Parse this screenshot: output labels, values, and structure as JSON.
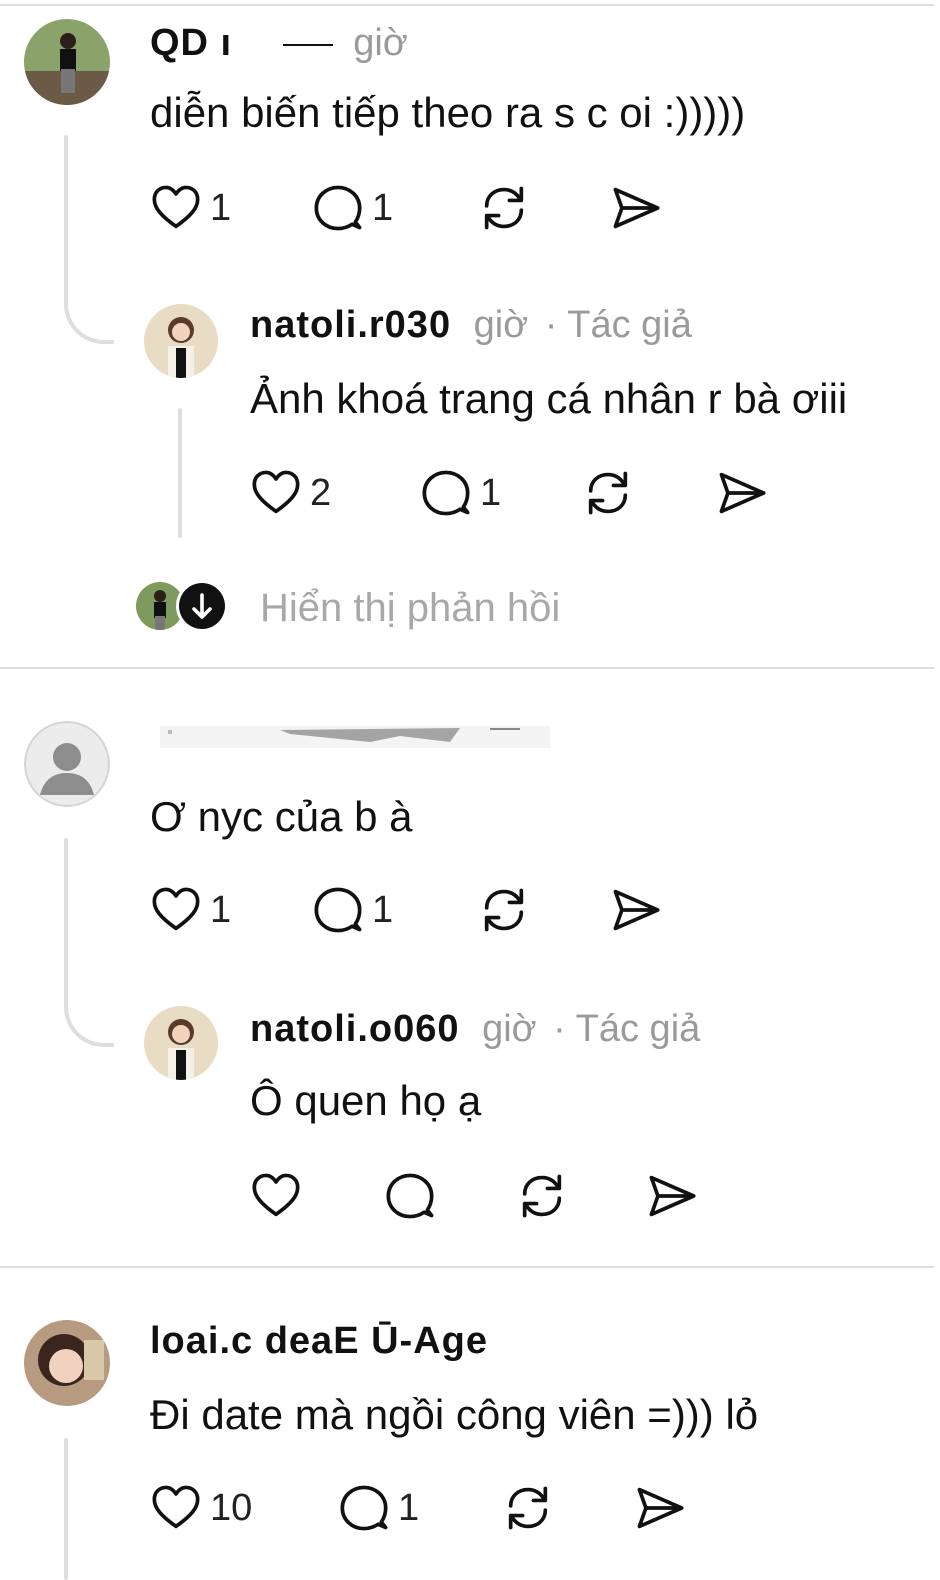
{
  "comments": [
    {
      "username": "QD ı",
      "time": "giờ",
      "text": "diễn biến tiếp theo ra s c oi :)))))",
      "likes": "1",
      "replies": "1",
      "reply": {
        "username": "natoli.r030",
        "time": "giờ",
        "author_badge": "· Tác giả",
        "text": "Ảnh khoá trang cá nhân r bà ơiii",
        "likes": "2",
        "replies": "1"
      },
      "show_replies": "Hiển thị phản hồi"
    },
    {
      "username": "",
      "time": "",
      "text": "Ơ nyc của b à",
      "likes": "1",
      "replies": "1",
      "reply": {
        "username": "natoli.o060",
        "time": "giờ",
        "author_badge": "· Tác giả",
        "text": "Ô quen họ ạ",
        "likes": "",
        "replies": ""
      }
    },
    {
      "username": "loai.c deaE Ū-Age",
      "time": "",
      "text": "Đi date mà ngồi công viên =))) lỏ",
      "likes": "10",
      "replies": "1"
    }
  ],
  "icons": [
    "heart-icon",
    "comment-icon",
    "repost-icon",
    "share-icon",
    "arrow-down-icon"
  ],
  "colors": {
    "divider": "#dedede",
    "muted": "#9a9a9a",
    "text": "#111111"
  }
}
